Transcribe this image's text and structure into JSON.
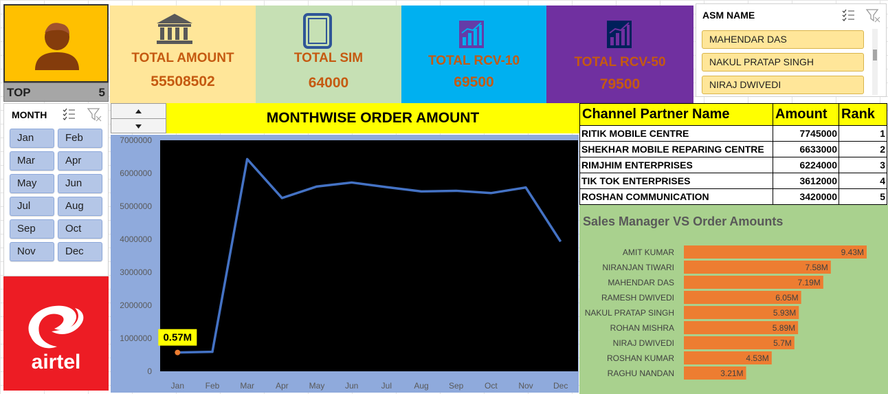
{
  "top": {
    "label": "TOP",
    "value": "5"
  },
  "kpis": [
    {
      "title": "TOTAL AMOUNT",
      "value": "55508502",
      "icon": "bank-icon"
    },
    {
      "title": "TOTAL SIM",
      "value": "64000",
      "icon": "tablet-icon"
    },
    {
      "title": "TOTAL RCV-10",
      "value": "69500",
      "icon": "bar-chart-icon"
    },
    {
      "title": "TOTAL RCV-50",
      "value": "79500",
      "icon": "bar-chart-icon"
    }
  ],
  "month_slicer": {
    "title": "MONTH",
    "items": [
      "Jan",
      "Feb",
      "Mar",
      "Apr",
      "May",
      "Jun",
      "Jul",
      "Aug",
      "Sep",
      "Oct",
      "Nov",
      "Dec"
    ]
  },
  "asm_slicer": {
    "title": "ASM NAME",
    "items": [
      "MAHENDAR DAS",
      "NAKUL PRATAP SINGH",
      "NIRAJ DWIVEDI"
    ]
  },
  "logo": {
    "text": "airtel"
  },
  "line_chart_title": "MONTHWISE ORDER AMOUNT",
  "table": {
    "headers": [
      "Channel Partner Name",
      "Amount",
      "Rank"
    ],
    "rows": [
      [
        "RITIK MOBILE CENTRE",
        "7745000",
        "1"
      ],
      [
        "SHEKHAR MOBILE REPARING CENTRE",
        "6633000",
        "2"
      ],
      [
        "RIMJHIM ENTERPRISES",
        "6224000",
        "3"
      ],
      [
        "TIK TOK ENTERPRISES",
        "3612000",
        "4"
      ],
      [
        "ROSHAN COMMUNICATION",
        "3420000",
        "5"
      ]
    ]
  },
  "colors": {
    "amount_card": "#ffe699",
    "sim_card": "#c6e0b4",
    "rcv10_card": "#00b0f0",
    "rcv50_card": "#7030a0",
    "line": "#4472c4",
    "bar": "#ed7d31",
    "airtel_red": "#ed1c24"
  },
  "chart_data": [
    {
      "type": "line",
      "title": "",
      "x": [
        "Jan",
        "Feb",
        "Mar",
        "Apr",
        "May",
        "Jun",
        "Jul",
        "Aug",
        "Sep",
        "Oct",
        "Nov",
        "Dec"
      ],
      "series": [
        {
          "values": [
            570000,
            590000,
            6430000,
            5250000,
            5600000,
            5720000,
            5580000,
            5450000,
            5470000,
            5400000,
            5570000,
            3930000
          ]
        }
      ],
      "ylim": [
        0,
        7000000
      ],
      "yticks": [
        "0",
        "1000000",
        "2000000",
        "3000000",
        "4000000",
        "5000000",
        "6000000",
        "7000000"
      ],
      "data_labels": [
        {
          "x": "Jan",
          "text": "0.57M"
        }
      ],
      "grid": false
    },
    {
      "type": "bar",
      "orientation": "horizontal",
      "title": "Sales Manager VS Order Amounts",
      "categories": [
        "AMIT KUMAR",
        "NIRANJAN TIWARI",
        "MAHENDAR DAS",
        "RAMESH DWIVEDI",
        "NAKUL PRATAP SINGH",
        "ROHAN MISHRA",
        "NIRAJ DWIVEDI",
        "ROSHAN KUMAR",
        "RAGHU NANDAN"
      ],
      "values": [
        9.43,
        7.58,
        7.19,
        6.05,
        5.93,
        5.89,
        5.7,
        4.53,
        3.21
      ],
      "labels": [
        "9.43M",
        "7.58M",
        "7.19M",
        "6.05M",
        "5.93M",
        "5.89M",
        "5.7M",
        "4.53M",
        "3.21M"
      ],
      "unit": "M"
    }
  ]
}
